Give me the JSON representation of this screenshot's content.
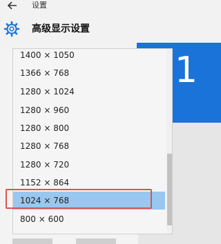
{
  "header": {
    "app_title": "设置",
    "page_title": "高级显示设置",
    "back_icon": "back-arrow-icon",
    "settings_icon": "gear-icon"
  },
  "monitor_preview": {
    "number": "1",
    "color": "#1a73d9"
  },
  "resolution_dropdown": {
    "options": [
      "1400 × 1050",
      "1366 × 768",
      "1280 × 1024",
      "1280 × 960",
      "1280 × 800",
      "1280 × 768",
      "1280 × 720",
      "1152 × 864",
      "1024 × 768",
      "800 × 600"
    ],
    "selected_value": "1024 × 768",
    "selected_index": 8
  },
  "colors": {
    "selection": "#99c7ef",
    "annotation_border": "#d9534f"
  }
}
